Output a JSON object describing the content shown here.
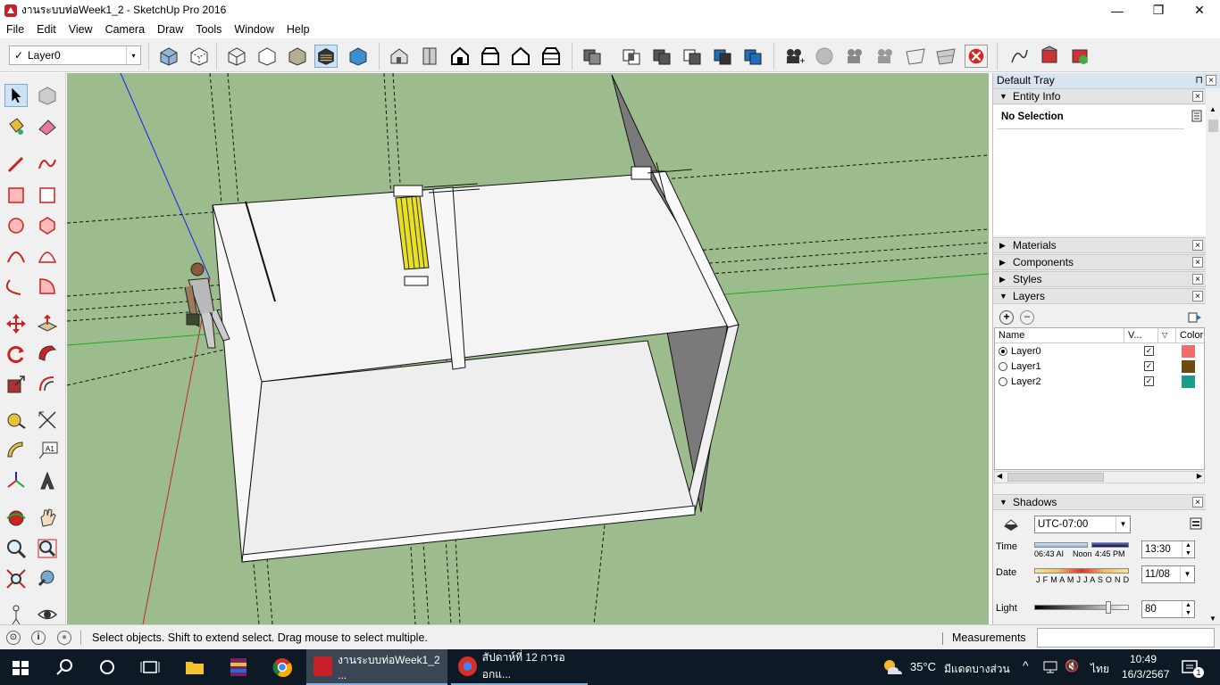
{
  "window": {
    "title": "งานระบบท่อWeek1_2 - SketchUp Pro 2016",
    "minimize": "—",
    "maximize": "❐",
    "close": "✕"
  },
  "menu": [
    "File",
    "Edit",
    "View",
    "Camera",
    "Draw",
    "Tools",
    "Window",
    "Help"
  ],
  "toolbar": {
    "layer_check": "✓",
    "layer_value": "Layer0",
    "dropdown_arrow": "▾"
  },
  "tray": {
    "title": "Default Tray",
    "pin": "📌",
    "close": "×",
    "entity_info": {
      "header": "Entity Info",
      "selection": "No Selection"
    },
    "panels": [
      "Materials",
      "Components",
      "Styles"
    ],
    "layers": {
      "header": "Layers",
      "columns": {
        "name": "Name",
        "visible": "V...",
        "color": "Color"
      },
      "rows": [
        {
          "name": "Layer0",
          "active": true,
          "visible": true,
          "color": "#f26b6b"
        },
        {
          "name": "Layer1",
          "active": false,
          "visible": true,
          "color": "#6e4a10"
        },
        {
          "name": "Layer2",
          "active": false,
          "visible": true,
          "color": "#1a9e8a"
        }
      ]
    },
    "shadows": {
      "header": "Shadows",
      "timezone": "UTC-07:00",
      "time_label": "Time",
      "time_start": "06:43 AI",
      "time_noon": "Noon",
      "time_end": "4:45 PM",
      "time_value": "13:30",
      "date_label": "Date",
      "months": "J F M A M J J A S O N D",
      "date_value": "11/08",
      "light_label": "Light",
      "light_value": "80"
    }
  },
  "status": {
    "message": "Select objects. Shift to extend select. Drag mouse to select multiple.",
    "measurements_label": "Measurements",
    "icon_geo": "⊙",
    "icon_info": "i",
    "icon_user": "●"
  },
  "taskbar": {
    "apps": [
      {
        "label": "งานระบบท่อWeek1_2 ..."
      },
      {
        "label": "สัปดาห์ที่ 12 การออกแ..."
      }
    ],
    "weather_temp": "35°C",
    "weather_desc": "มีแดดบางส่วน",
    "language": "ไทย",
    "time": "10:49",
    "date": "16/3/2567",
    "notification_count": "1"
  },
  "colors": {
    "viewport_bg": "#9cbc8d",
    "tray_title_bg": "#d8e4f0",
    "taskbar_bg": "#0d1a26"
  }
}
